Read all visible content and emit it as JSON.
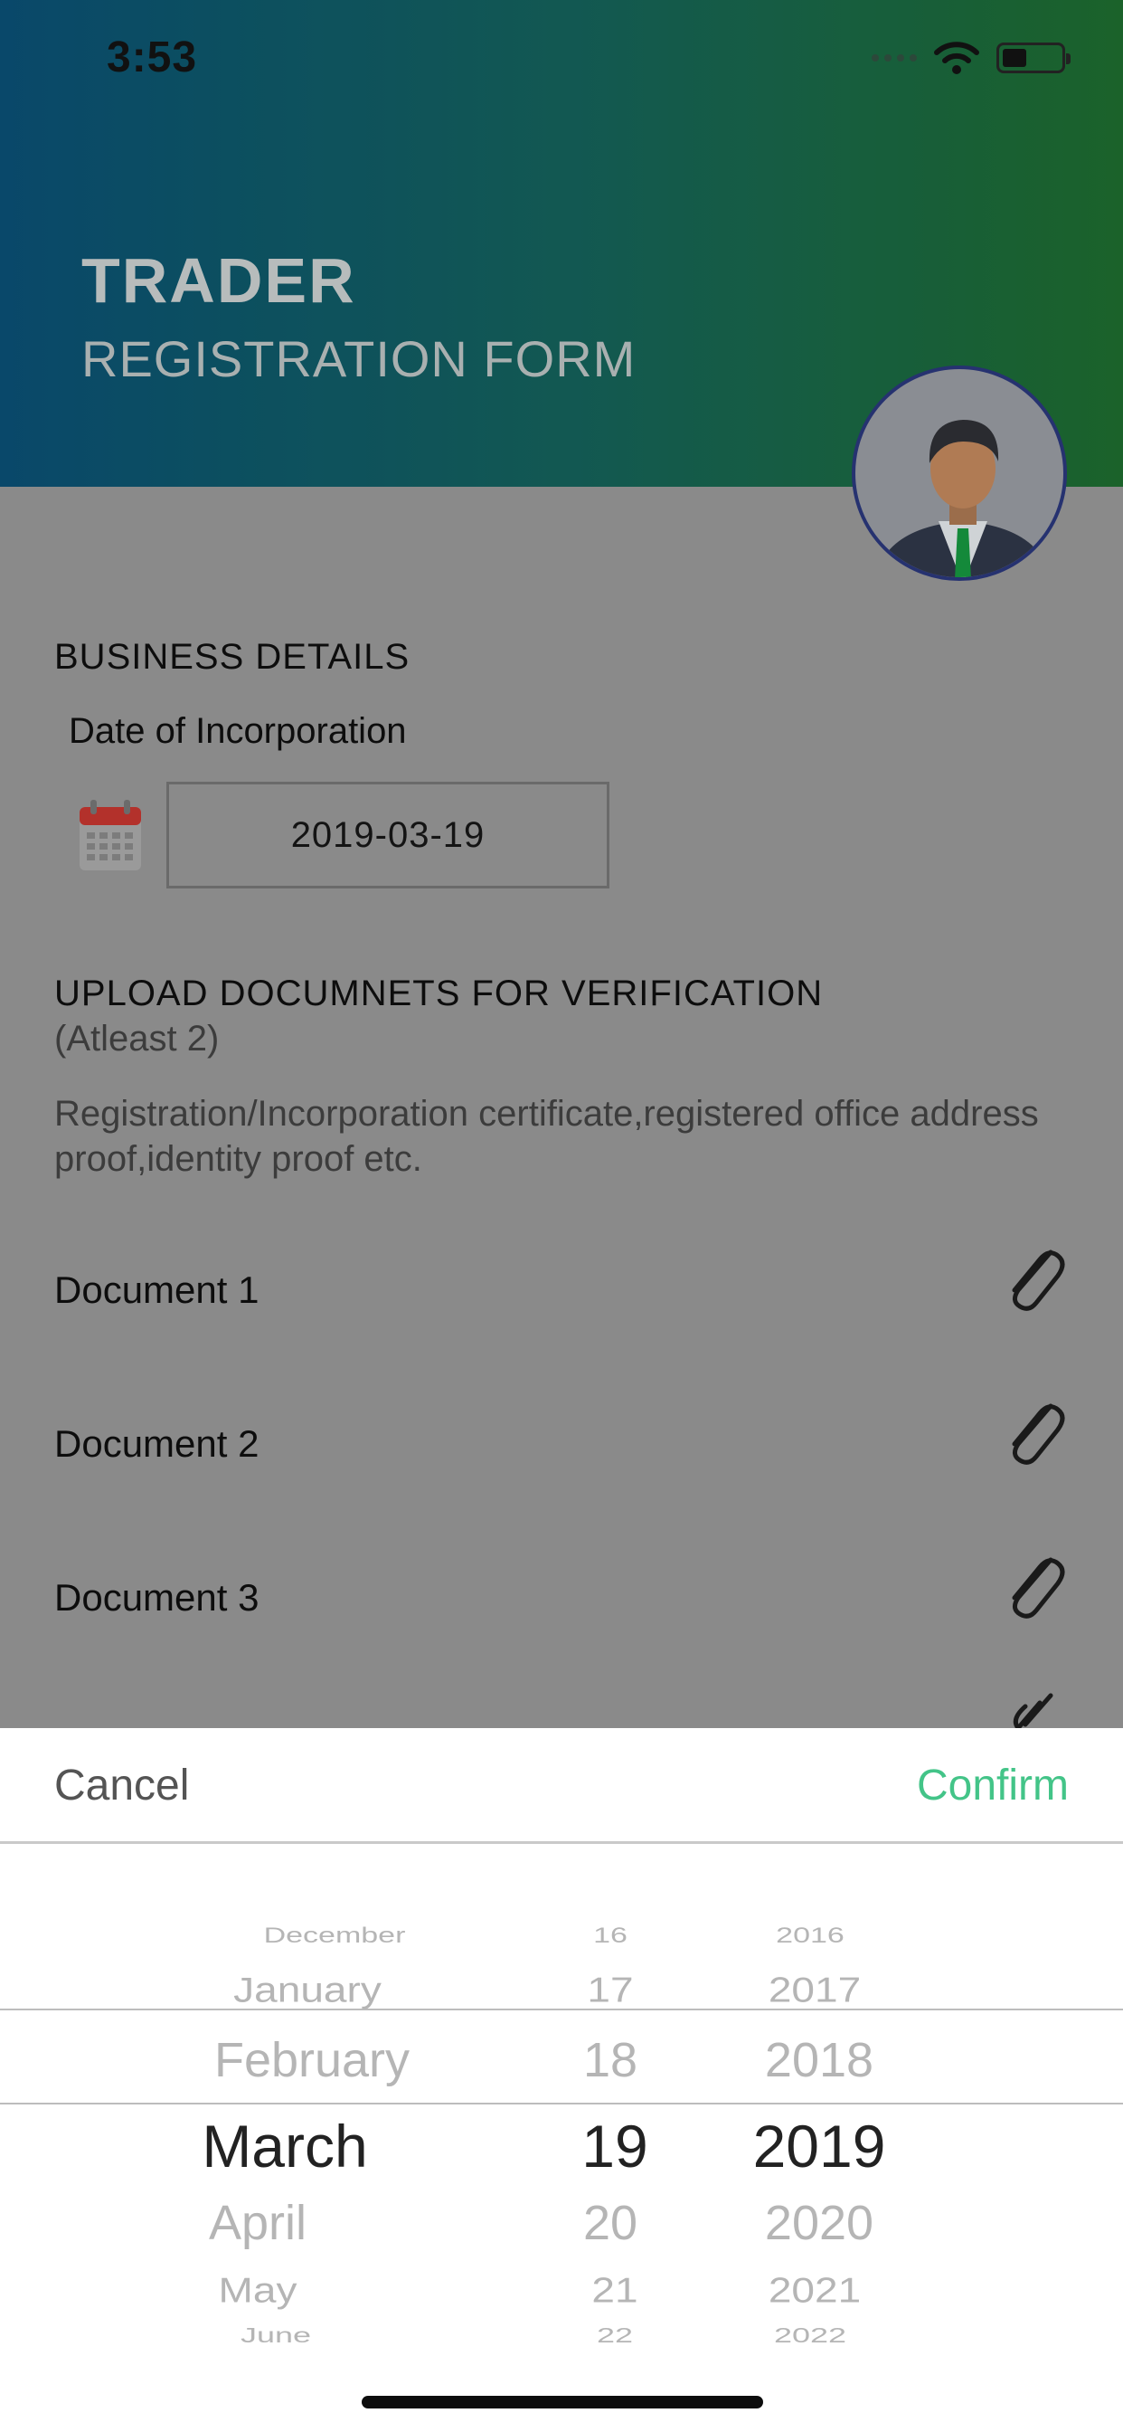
{
  "status_bar": {
    "time": "3:53"
  },
  "header": {
    "title": "TRADER",
    "subtitle": "REGISTRATION FORM"
  },
  "business": {
    "section_title": "BUSINESS DETAILS",
    "date_label": "Date of Incorporation",
    "date_value": "2019-03-19"
  },
  "upload": {
    "title": "UPLOAD DOCUMNETS FOR VERIFICATION",
    "subtitle": "(Atleast 2)",
    "description": "Registration/Incorporation certificate,registered office address proof,identity proof etc.",
    "documents": [
      "Document 1",
      "Document 2",
      "Document 3"
    ]
  },
  "picker": {
    "cancel_label": "Cancel",
    "confirm_label": "Confirm",
    "months": [
      "December",
      "January",
      "February",
      "March",
      "April",
      "May",
      "June"
    ],
    "days": [
      "16",
      "17",
      "18",
      "19",
      "20",
      "21",
      "22"
    ],
    "years": [
      "2016",
      "2017",
      "2018",
      "2019",
      "2020",
      "2021",
      "2022"
    ],
    "selected": {
      "month": "March",
      "day": "19",
      "year": "2019"
    }
  },
  "colors": {
    "confirm": "#43c488",
    "header_start": "#0a4f73",
    "header_end": "#1e6b2e"
  },
  "icons": [
    "calendar-icon",
    "paperclip-icon",
    "avatar-icon",
    "wifi-icon",
    "battery-icon"
  ]
}
